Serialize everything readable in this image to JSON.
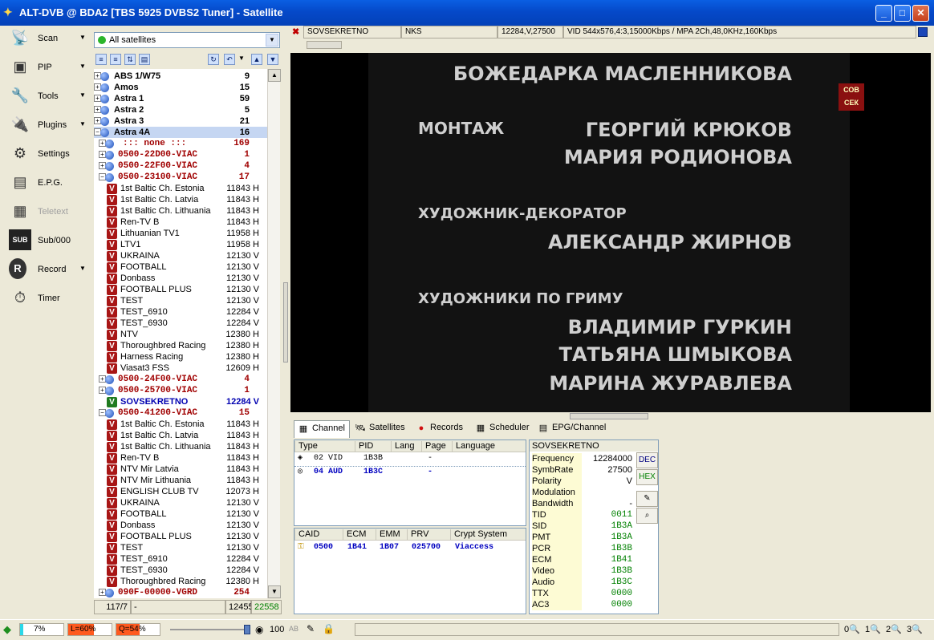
{
  "window": {
    "title": "ALT-DVB @ BDA2 [TBS 5925 DVBS2 Tuner] - Satellite",
    "min": "_",
    "max": "□",
    "close": "✕"
  },
  "sidebar": {
    "items": [
      {
        "label": "Scan",
        "icon": "scan-icon",
        "glyph": "📡",
        "arrow": "▼"
      },
      {
        "label": "PIP",
        "icon": "pip-icon",
        "glyph": "▣",
        "arrow": "▼"
      },
      {
        "label": "Tools",
        "icon": "tools-icon",
        "glyph": "🔧",
        "arrow": "▼"
      },
      {
        "label": "Plugins",
        "icon": "plugins-icon",
        "glyph": "🔌",
        "arrow": "▼"
      },
      {
        "label": "Settings",
        "icon": "settings-icon",
        "glyph": "⚙",
        "arrow": ""
      },
      {
        "label": "E.P.G.",
        "icon": "epg-icon",
        "glyph": "▤",
        "arrow": ""
      },
      {
        "label": "Teletext",
        "icon": "teletext-icon",
        "glyph": "▦",
        "arrow": ""
      },
      {
        "label": "Sub/000",
        "icon": "sub-icon",
        "glyph": "SUB",
        "arrow": ""
      },
      {
        "label": "Record",
        "icon": "record-icon",
        "glyph": "R",
        "arrow": "▼"
      },
      {
        "label": "Timer",
        "icon": "timer-icon",
        "glyph": "⏱",
        "arrow": ""
      }
    ]
  },
  "satellite_selector": {
    "value": "All satellites"
  },
  "tree": {
    "rows": [
      {
        "kind": "sat",
        "exp": "+",
        "name": "ABS 1/W75",
        "count": "9"
      },
      {
        "kind": "sat",
        "exp": "+",
        "name": "Amos",
        "count": "15"
      },
      {
        "kind": "sat",
        "exp": "+",
        "name": "Astra 1",
        "count": "59"
      },
      {
        "kind": "sat",
        "exp": "+",
        "name": "Astra 2",
        "count": "5"
      },
      {
        "kind": "sat",
        "exp": "+",
        "name": "Astra 3",
        "count": "21"
      },
      {
        "kind": "sat sel",
        "exp": "−",
        "name": "Astra 4A",
        "count": "16"
      },
      {
        "kind": "grp",
        "exp": "+",
        "name": "::: none :::",
        "count": "169"
      },
      {
        "kind": "grp",
        "exp": "+",
        "name": "0500-22D00-VIAC",
        "count": "1"
      },
      {
        "kind": "grp",
        "exp": "+",
        "name": "0500-22F00-VIAC",
        "count": "4"
      },
      {
        "kind": "grp",
        "exp": "−",
        "name": "0500-23100-VIAC",
        "count": "17"
      },
      {
        "kind": "ch",
        "name": "1st Baltic Ch. Estonia",
        "count": "11843 H"
      },
      {
        "kind": "ch",
        "name": "1st Baltic Ch. Latvia",
        "count": "11843 H"
      },
      {
        "kind": "ch",
        "name": "1st Baltic Ch. Lithuania",
        "count": "11843 H"
      },
      {
        "kind": "ch",
        "name": "Ren-TV B",
        "count": "11843 H"
      },
      {
        "kind": "ch",
        "name": "Lithuanian TV1",
        "count": "11958 H"
      },
      {
        "kind": "ch",
        "name": "LTV1",
        "count": "11958 H"
      },
      {
        "kind": "ch",
        "name": "UKRAINA",
        "count": "12130 V"
      },
      {
        "kind": "ch",
        "name": "FOOTBALL",
        "count": "12130 V"
      },
      {
        "kind": "ch",
        "name": "Donbass",
        "count": "12130 V"
      },
      {
        "kind": "ch",
        "name": "FOOTBALL PLUS",
        "count": "12130 V"
      },
      {
        "kind": "ch",
        "name": "TEST",
        "count": "12130 V"
      },
      {
        "kind": "ch",
        "name": "TEST_6910",
        "count": "12284 V"
      },
      {
        "kind": "ch",
        "name": "TEST_6930",
        "count": "12284 V"
      },
      {
        "kind": "ch",
        "name": "NTV",
        "count": "12380 H"
      },
      {
        "kind": "ch",
        "name": "Thoroughbred Racing",
        "count": "12380 H"
      },
      {
        "kind": "ch",
        "name": "Harness Racing",
        "count": "12380 H"
      },
      {
        "kind": "ch",
        "name": "Viasat3 FSS",
        "count": "12609 H"
      },
      {
        "kind": "grp",
        "exp": "+",
        "name": "0500-24F00-VIAC",
        "count": "4"
      },
      {
        "kind": "grp",
        "exp": "+",
        "name": "0500-25700-VIAC",
        "count": "1"
      },
      {
        "kind": "ch ch2",
        "name": "SOVSEKRETNO",
        "count": "12284 V",
        "green": true
      },
      {
        "kind": "grp",
        "exp": "−",
        "name": "0500-41200-VIAC",
        "count": "15"
      },
      {
        "kind": "ch",
        "name": "1st Baltic Ch. Estonia",
        "count": "11843 H"
      },
      {
        "kind": "ch",
        "name": "1st Baltic Ch. Latvia",
        "count": "11843 H"
      },
      {
        "kind": "ch",
        "name": "1st Baltic Ch. Lithuania",
        "count": "11843 H"
      },
      {
        "kind": "ch",
        "name": "Ren-TV B",
        "count": "11843 H"
      },
      {
        "kind": "ch",
        "name": "NTV Mir Latvia",
        "count": "11843 H"
      },
      {
        "kind": "ch",
        "name": "NTV Mir Lithuania",
        "count": "11843 H"
      },
      {
        "kind": "ch",
        "name": "ENGLISH CLUB TV",
        "count": "12073 H"
      },
      {
        "kind": "ch",
        "name": "UKRAINA",
        "count": "12130 V"
      },
      {
        "kind": "ch",
        "name": "FOOTBALL",
        "count": "12130 V"
      },
      {
        "kind": "ch",
        "name": "Donbass",
        "count": "12130 V"
      },
      {
        "kind": "ch",
        "name": "FOOTBALL PLUS",
        "count": "12130 V"
      },
      {
        "kind": "ch",
        "name": "TEST",
        "count": "12130 V"
      },
      {
        "kind": "ch",
        "name": "TEST_6910",
        "count": "12284 V"
      },
      {
        "kind": "ch",
        "name": "TEST_6930",
        "count": "12284 V"
      },
      {
        "kind": "ch",
        "name": "Thoroughbred Racing",
        "count": "12380 H"
      },
      {
        "kind": "grp",
        "exp": "+",
        "name": "090F-00000-VGRD",
        "count": "254"
      }
    ]
  },
  "tree_status": {
    "pos": "117/7",
    "sep": "-",
    "total": "12455",
    "count2": "22558"
  },
  "infobar": {
    "channel": "SOVSEKRETNO",
    "provider": "NKS",
    "tp": "12284,V,27500",
    "video": "VID 544x576,4:3,15000Kbps / MPA 2Ch,48,0KHz,160Kbps"
  },
  "video": {
    "credits": [
      "БОЖЕДАРКА МАСЛЕННИКОВА",
      "МОНТАЖ",
      "ГЕОРГИЙ КРЮКОВ",
      "МАРИЯ РОДИОНОВА",
      "ХУДОЖНИК-ДЕКОРАТОР",
      "АЛЕКСАНДР ЖИРНОВ",
      "ХУДОЖНИКИ ПО ГРИМУ",
      "ВЛАДИМИР ГУРКИН",
      "ТАТЬЯНА ШМЫКОВА",
      "МАРИНА ЖУРАВЛЕВА"
    ],
    "logo": "СОВ СЕК"
  },
  "tabs": [
    {
      "label": "Channel",
      "icon": "channel-icon",
      "glyph": "▦"
    },
    {
      "label": "Satellites",
      "icon": "satellites-icon",
      "glyph": "🛰"
    },
    {
      "label": "Records",
      "icon": "records-icon",
      "glyph": "●"
    },
    {
      "label": "Scheduler",
      "icon": "scheduler-icon",
      "glyph": "▦"
    },
    {
      "label": "EPG/Channel",
      "icon": "epg-channel-icon",
      "glyph": "▤"
    }
  ],
  "pid_table": {
    "headers": [
      "Type",
      "PID",
      "Lang",
      "Page",
      "Language"
    ],
    "rows": [
      {
        "type": "02 VID",
        "pid": "1B3B",
        "lang": "",
        "page": "-",
        "language": ""
      },
      {
        "type": "04 AUD",
        "pid": "1B3C",
        "lang": "",
        "page": "-",
        "language": ""
      }
    ]
  },
  "caid_table": {
    "headers": [
      "CAID",
      "ECM",
      "EMM",
      "PRV",
      "Crypt System"
    ],
    "rows": [
      {
        "caid": "0500",
        "ecm": "1B41",
        "emm": "1B07",
        "prv": "025700",
        "crypt": "Viaccess"
      }
    ]
  },
  "info_panel": {
    "title": "SOVSEKRETNO",
    "rows": [
      {
        "k": "Frequency",
        "v": "12284000",
        "g": false
      },
      {
        "k": "SymbRate",
        "v": "27500",
        "g": false
      },
      {
        "k": "Polarity",
        "v": "V",
        "g": false
      },
      {
        "k": "Modulation",
        "v": "",
        "g": false
      },
      {
        "k": "Bandwidth",
        "v": "-",
        "g": false
      },
      {
        "k": "TID",
        "v": "0011",
        "g": true
      },
      {
        "k": "SID",
        "v": "1B3A",
        "g": true
      },
      {
        "k": "PMT",
        "v": "1B3A",
        "g": true
      },
      {
        "k": "PCR",
        "v": "1B3B",
        "g": true
      },
      {
        "k": "ECM",
        "v": "1B41",
        "g": true
      },
      {
        "k": "Video",
        "v": "1B3B",
        "g": true
      },
      {
        "k": "Audio",
        "v": "1B3C",
        "g": true
      },
      {
        "k": "TTX",
        "v": "0000",
        "g": true
      },
      {
        "k": "AC3",
        "v": "0000",
        "g": true
      }
    ]
  },
  "dec_buttons": {
    "dec": "DEC",
    "hex": "HEX"
  },
  "statusbar": {
    "signal": "7%",
    "level": "L=60%",
    "quality": "Q=54%",
    "volume": "100",
    "ab": "AB",
    "zoom": [
      "0",
      "1",
      "2",
      "3"
    ],
    "level_fraction": 0.6,
    "quality_fraction": 0.54,
    "signal_fraction": 0.07,
    "volume_fraction": 1.0
  },
  "colors": {
    "titlebar": "#0549c9",
    "accent_blue": "#0000c0",
    "group_red": "#a00000",
    "channel_badge": "#a81616",
    "level_bar": "#ff5a1e",
    "quality_bar": "#ff5a1e",
    "signal_bar": "#2ad8e8"
  }
}
